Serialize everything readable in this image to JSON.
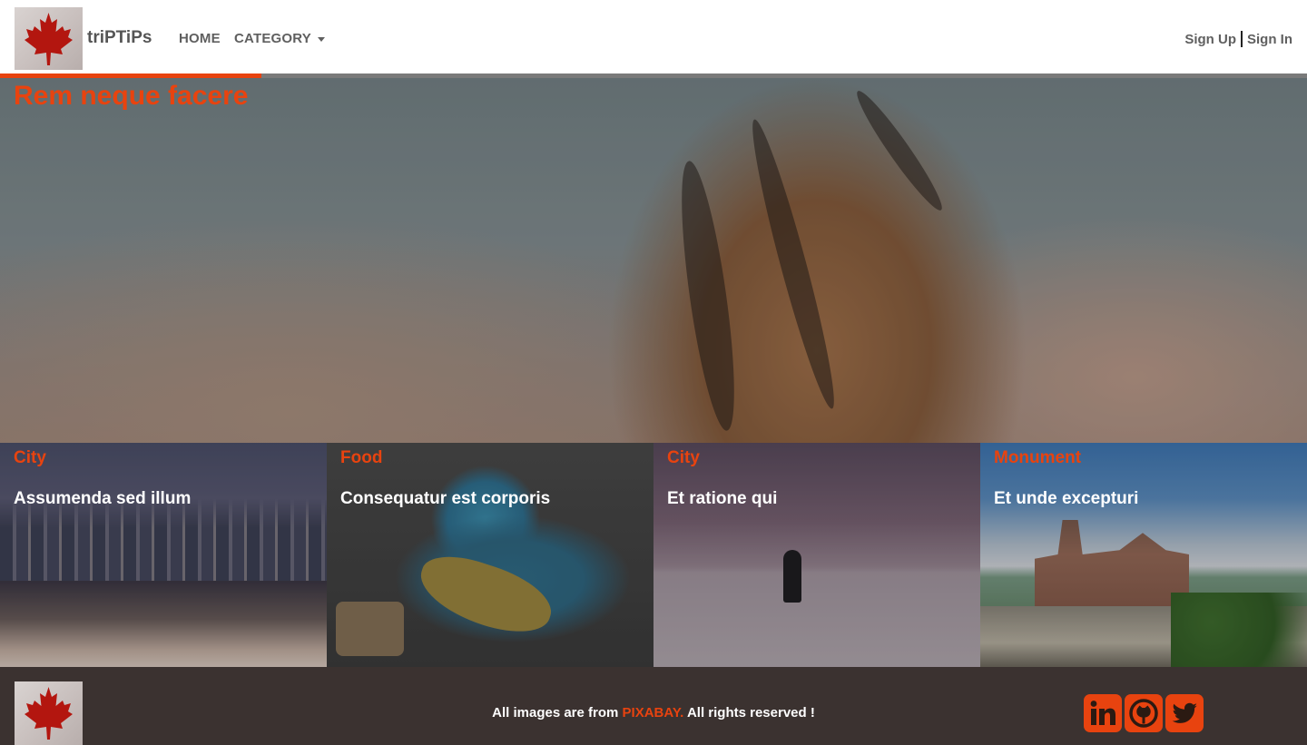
{
  "nav": {
    "brand": "triPTiPs",
    "home_label": "HOME",
    "category_label": "CATEGORY",
    "signup_label": "Sign Up",
    "signin_label": "Sign In"
  },
  "hero": {
    "title": "Rem neque facere",
    "progress_fraction": 0.2
  },
  "cards": [
    {
      "category": "City",
      "title": "Assumenda sed illum"
    },
    {
      "category": "Food",
      "title": "Consequatur est corporis"
    },
    {
      "category": "City",
      "title": "Et ratione qui"
    },
    {
      "category": "Monument",
      "title": "Et unde excepturi"
    }
  ],
  "footer": {
    "text_before": "All images are from ",
    "source_name": "PIXABAY.",
    "text_after": " All rights reserved !",
    "social": [
      "linkedin-icon",
      "github-icon",
      "twitter-icon"
    ]
  },
  "colors": {
    "accent": "#e8430f",
    "footer_bg": "#3b3230",
    "nav_text": "#5f5f5f"
  }
}
